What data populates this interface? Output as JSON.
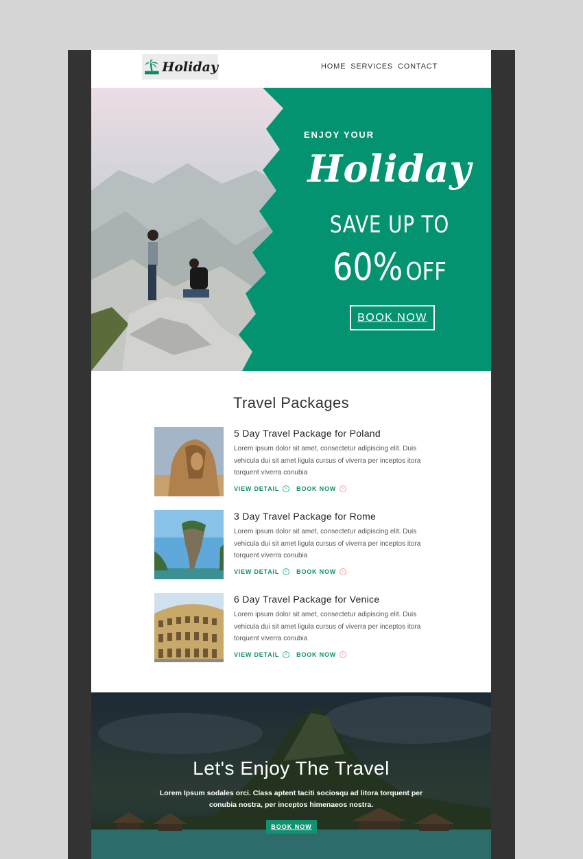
{
  "header": {
    "logo_text": "Holiday",
    "nav": [
      "HOME",
      "SERVICES",
      "CONTACT"
    ]
  },
  "hero": {
    "eyebrow": "ENJOY YOUR",
    "script_title": "Holiday",
    "save_line": "SAVE UP TO",
    "percent": "60%",
    "off": "OFF",
    "button": "BOOK NOW"
  },
  "packages": {
    "title": "Travel Packages",
    "items": [
      {
        "title": "5 Day Travel Package for Poland",
        "description": "Lorem ipsum dolor sit amet, consectetur adipiscing elit. Duis vehicula dui sit amet ligula cursus of viverra per inceptos itora torquent viverra conubia",
        "view_label": "VIEW DETAIL",
        "book_label": "BOOK NOW",
        "image_name": "sphinx-photo"
      },
      {
        "title": "3 Day Travel Package for Rome",
        "description": "Lorem ipsum dolor sit amet, consectetur adipiscing elit. Duis vehicula dui sit amet ligula cursus of viverra per inceptos itora torquent viverra conubia",
        "view_label": "VIEW DETAIL",
        "book_label": "BOOK NOW",
        "image_name": "rock-island-photo"
      },
      {
        "title": "6 Day Travel Package for Venice",
        "description": "Lorem ipsum dolor sit amet, consectetur adipiscing elit. Duis vehicula dui sit amet ligula cursus of viverra per inceptos itora torquent viverra conubia",
        "view_label": "VIEW DETAIL",
        "book_label": "BOOK NOW",
        "image_name": "colosseum-photo"
      }
    ]
  },
  "banner": {
    "title": "Let's Enjoy The Travel",
    "text": "Lorem Ipsum sodales orci. Class aptent taciti sociosqu ad litora torquent per conubia nostra, per inceptos himenaeos nostra.",
    "button": "BOOK NOW"
  },
  "colors": {
    "brand_green": "#049370",
    "link_green": "#0f8f6c",
    "frame_dark": "#333333",
    "page_bg": "#d6d6d6"
  }
}
